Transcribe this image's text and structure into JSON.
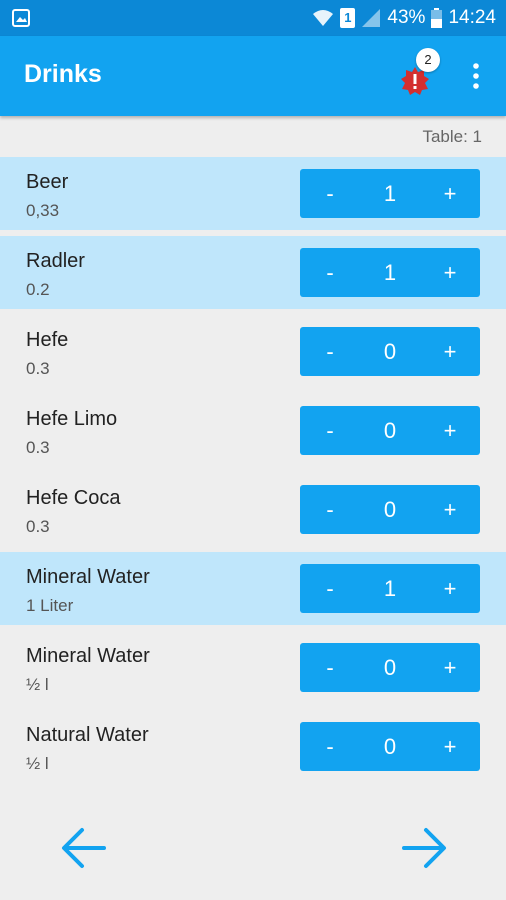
{
  "status_bar": {
    "sim": "1",
    "battery": "43%",
    "time": "14:24"
  },
  "app_bar": {
    "title": "Drinks",
    "badge_count": "2"
  },
  "table_label": "Table: 1",
  "drinks": [
    {
      "name": "Beer",
      "size": " 0,33",
      "qty": "1",
      "selected": true
    },
    {
      "name": "Radler",
      "size": "0.2",
      "qty": "1",
      "selected": true
    },
    {
      "name": "Hefe",
      "size": "0.3",
      "qty": "0",
      "selected": false
    },
    {
      "name": "Hefe Limo",
      "size": "0.3",
      "qty": "0",
      "selected": false
    },
    {
      "name": "Hefe Coca",
      "size": "0.3",
      "qty": "0",
      "selected": false
    },
    {
      "name": "Mineral Water",
      "size": "1 Liter",
      "qty": "1",
      "selected": true
    },
    {
      "name": "Mineral Water",
      "size": "½ l",
      "qty": "0",
      "selected": false
    },
    {
      "name": "Natural Water",
      "size": "½ l",
      "qty": "0",
      "selected": false
    }
  ],
  "stepper": {
    "minus": "-",
    "plus": "+"
  },
  "colors": {
    "primary": "#12a3f0",
    "status_bar": "#0c88d6",
    "selected_row": "#bfe6fb",
    "alert": "#d32f2f"
  },
  "icons": {
    "back": "arrow-left-icon",
    "forward": "arrow-right-icon",
    "alert": "alert-badge-icon",
    "menu": "more-vert-icon"
  }
}
